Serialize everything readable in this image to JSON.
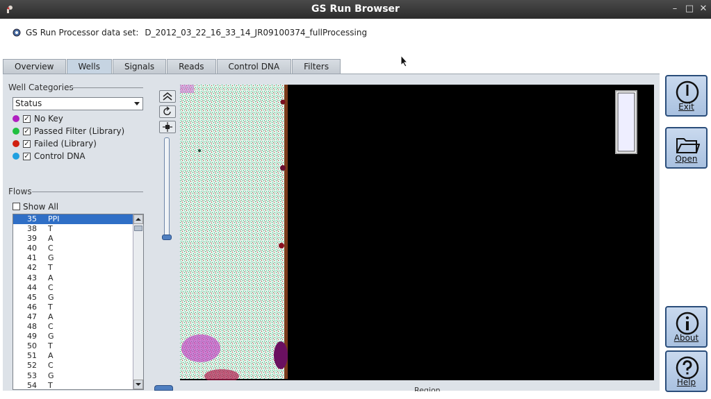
{
  "window": {
    "title": "GS Run Browser",
    "minimize": "–",
    "maximize": "□",
    "close": "✕"
  },
  "dataset": {
    "label": "GS Run Processor data set:",
    "value": "D_2012_03_22_16_33_14_JR09100374_fullProcessing"
  },
  "tabs": [
    {
      "label": "Overview"
    },
    {
      "label": "Wells",
      "active": true
    },
    {
      "label": "Signals"
    },
    {
      "label": "Reads"
    },
    {
      "label": "Control DNA"
    },
    {
      "label": "Filters"
    }
  ],
  "well_categories": {
    "title": "Well Categories",
    "select_value": "Status",
    "items": [
      {
        "label": "No Key",
        "color": "#b020c0",
        "checked": true
      },
      {
        "label": "Passed Filter (Library)",
        "color": "#20c040",
        "checked": true
      },
      {
        "label": "Failed (Library)",
        "color": "#d02010",
        "checked": true
      },
      {
        "label": "Control DNA",
        "color": "#20a0e0",
        "checked": true
      }
    ]
  },
  "flows": {
    "title": "Flows",
    "show_all": "Show All",
    "rows": [
      {
        "num": "35",
        "base": "PPI",
        "selected": true
      },
      {
        "num": "38",
        "base": "T"
      },
      {
        "num": "39",
        "base": "A"
      },
      {
        "num": "40",
        "base": "C"
      },
      {
        "num": "41",
        "base": "G"
      },
      {
        "num": "42",
        "base": "T"
      },
      {
        "num": "43",
        "base": "A"
      },
      {
        "num": "44",
        "base": "C"
      },
      {
        "num": "45",
        "base": "G"
      },
      {
        "num": "46",
        "base": "T"
      },
      {
        "num": "47",
        "base": "A"
      },
      {
        "num": "48",
        "base": "C"
      },
      {
        "num": "49",
        "base": "G"
      },
      {
        "num": "50",
        "base": "T"
      },
      {
        "num": "51",
        "base": "A"
      },
      {
        "num": "52",
        "base": "C"
      },
      {
        "num": "53",
        "base": "G"
      },
      {
        "num": "54",
        "base": "T"
      }
    ]
  },
  "image": {
    "region_label": "Region"
  },
  "buttons": {
    "exit": "Exit",
    "open": "Open",
    "about": "About",
    "help": "Help"
  }
}
